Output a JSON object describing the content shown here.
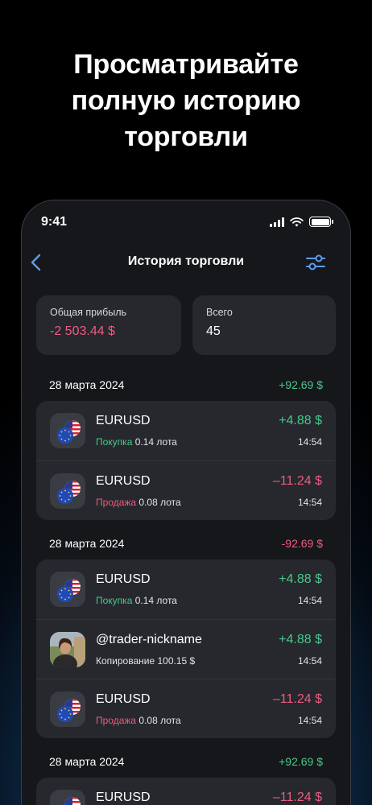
{
  "promo": {
    "line1": "Просматривайте",
    "line2": "полную историю",
    "line3": "торговли"
  },
  "status_bar": {
    "time": "9:41"
  },
  "nav": {
    "title": "История торговли"
  },
  "summary": {
    "profit_label": "Общая прибыль",
    "profit_value": "-2 503.44 $",
    "total_label": "Всего",
    "total_value": "45"
  },
  "days": [
    {
      "date": "28 марта 2024",
      "sum": "+92.69 $",
      "trades": [
        {
          "symbol": "EURUSD",
          "side": "Покупка",
          "detail": " 0.14 лота",
          "amount": "+4.88 $",
          "time": "14:54"
        },
        {
          "symbol": "EURUSD",
          "side": "Продажа",
          "detail": " 0.08 лота",
          "amount": "–11.24 $",
          "time": "14:54"
        }
      ]
    },
    {
      "date": "28 марта 2024",
      "sum": "-92.69 $",
      "trades": [
        {
          "symbol": "EURUSD",
          "side": "Покупка",
          "detail": " 0.14 лота",
          "amount": "+4.88 $",
          "time": "14:54"
        },
        {
          "symbol": "@trader-nickname",
          "side": "",
          "detail": "Копирование 100.15 $",
          "amount": "+4.88 $",
          "time": "14:54"
        },
        {
          "symbol": "EURUSD",
          "side": "Продажа",
          "detail": " 0.08 лота",
          "amount": "–11.24 $",
          "time": "14:54"
        }
      ]
    },
    {
      "date": "28 марта 2024",
      "sum": "+92.69 $",
      "trades": [
        {
          "symbol": "EURUSD",
          "side": "",
          "detail": "",
          "amount": "–11.24 $",
          "time": ""
        }
      ]
    }
  ],
  "colors": {
    "positive": "#48c98a",
    "negative": "#ef5b7e",
    "accent": "#5b9cf0"
  },
  "icons": {
    "back": "chevron-left-icon",
    "filter": "sliders-icon",
    "currency": "eu-us-flags-icon"
  }
}
